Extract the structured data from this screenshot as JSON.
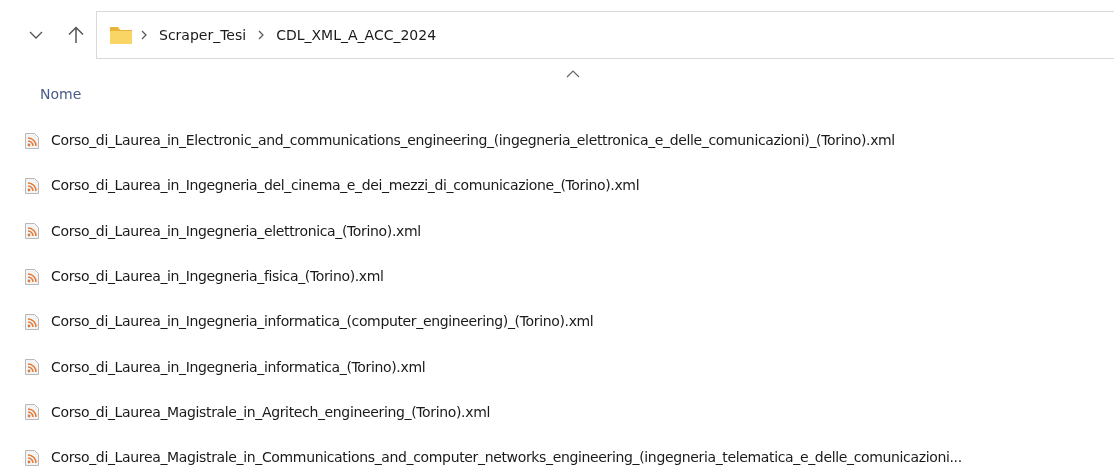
{
  "toolbar": {
    "breadcrumbs": [
      "Scraper_Tesi",
      "CDL_XML_A_ACC_2024"
    ]
  },
  "column_header": {
    "label": "Nome",
    "sorted_ascending": true
  },
  "files": [
    {
      "name": "Corso_di_Laurea_in_Electronic_and_communications_engineering_(ingegneria_elettronica_e_delle_comunicazioni)_(Torino).xml"
    },
    {
      "name": "Corso_di_Laurea_in_Ingegneria_del_cinema_e_dei_mezzi_di_comunicazione_(Torino).xml"
    },
    {
      "name": "Corso_di_Laurea_in_Ingegneria_elettronica_(Torino).xml"
    },
    {
      "name": "Corso_di_Laurea_in_Ingegneria_fisica_(Torino).xml"
    },
    {
      "name": "Corso_di_Laurea_in_Ingegneria_informatica_(computer_engineering)_(Torino).xml"
    },
    {
      "name": "Corso_di_Laurea_in_Ingegneria_informatica_(Torino).xml"
    },
    {
      "name": "Corso_di_Laurea_Magistrale_in_Agritech_engineering_(Torino).xml"
    },
    {
      "name": "Corso_di_Laurea_Magistrale_in_Communications_and_computer_networks_engineering_(ingegneria_telematica_e_delle_comunicazioni..."
    }
  ]
}
